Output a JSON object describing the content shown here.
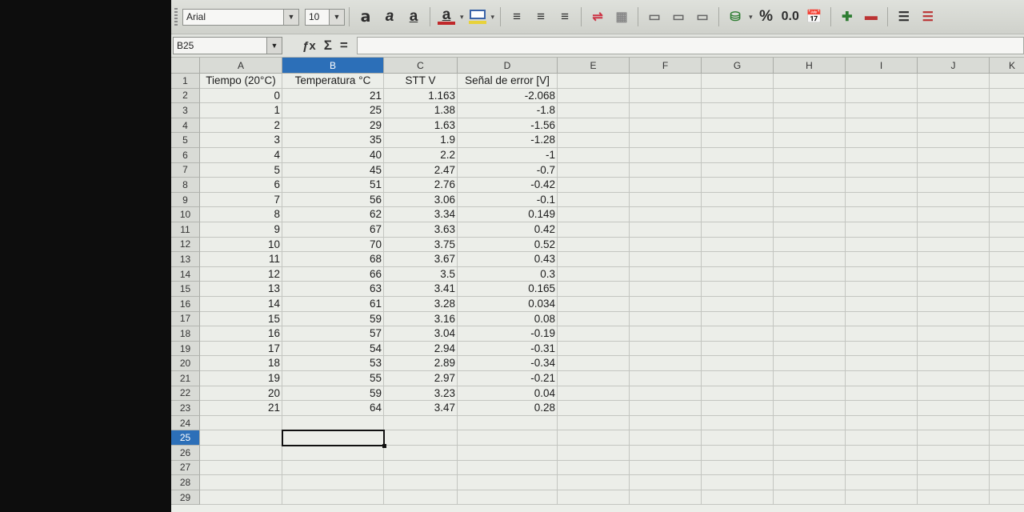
{
  "toolbar": {
    "font_name": "Arial",
    "font_size": "10",
    "percent_label": "%",
    "decimal_label": "0.0"
  },
  "formula_bar": {
    "cell_ref": "B25",
    "sum_symbol": "Σ",
    "equals_symbol": "=",
    "content": ""
  },
  "selected_cell": {
    "column": "B",
    "row": 25
  },
  "columns": [
    "A",
    "B",
    "C",
    "D",
    "E",
    "F",
    "G",
    "H",
    "I",
    "J",
    "K"
  ],
  "row_numbers": [
    1,
    2,
    3,
    4,
    5,
    6,
    7,
    8,
    9,
    10,
    11,
    12,
    13,
    14,
    15,
    16,
    17,
    18,
    19,
    20,
    21,
    22,
    23,
    24,
    25,
    26,
    27,
    28,
    29
  ],
  "sheet": {
    "headers": [
      "Tiempo (20°C)",
      "Temperatura °C",
      "STT V",
      "Señal de error [V]"
    ],
    "rows": [
      [
        "0",
        "21",
        "1.163",
        "-2.068"
      ],
      [
        "1",
        "25",
        "1.38",
        "-1.8"
      ],
      [
        "2",
        "29",
        "1.63",
        "-1.56"
      ],
      [
        "3",
        "35",
        "1.9",
        "-1.28"
      ],
      [
        "4",
        "40",
        "2.2",
        "-1"
      ],
      [
        "5",
        "45",
        "2.47",
        "-0.7"
      ],
      [
        "6",
        "51",
        "2.76",
        "-0.42"
      ],
      [
        "7",
        "56",
        "3.06",
        "-0.1"
      ],
      [
        "8",
        "62",
        "3.34",
        "0.149"
      ],
      [
        "9",
        "67",
        "3.63",
        "0.42"
      ],
      [
        "10",
        "70",
        "3.75",
        "0.52"
      ],
      [
        "11",
        "68",
        "3.67",
        "0.43"
      ],
      [
        "12",
        "66",
        "3.5",
        "0.3"
      ],
      [
        "13",
        "63",
        "3.41",
        "0.165"
      ],
      [
        "14",
        "61",
        "3.28",
        "0.034"
      ],
      [
        "15",
        "59",
        "3.16",
        "0.08"
      ],
      [
        "16",
        "57",
        "3.04",
        "-0.19"
      ],
      [
        "17",
        "54",
        "2.94",
        "-0.31"
      ],
      [
        "18",
        "53",
        "2.89",
        "-0.34"
      ],
      [
        "19",
        "55",
        "2.97",
        "-0.21"
      ],
      [
        "20",
        "59",
        "3.23",
        "0.04"
      ],
      [
        "21",
        "64",
        "3.47",
        "0.28"
      ]
    ]
  },
  "colors": {
    "selection_header": "#2c6fb8",
    "font_color_swatch": "#c0282a",
    "highlight_swatch": "#e8d23a",
    "background_swatch": "#3a63a8"
  }
}
